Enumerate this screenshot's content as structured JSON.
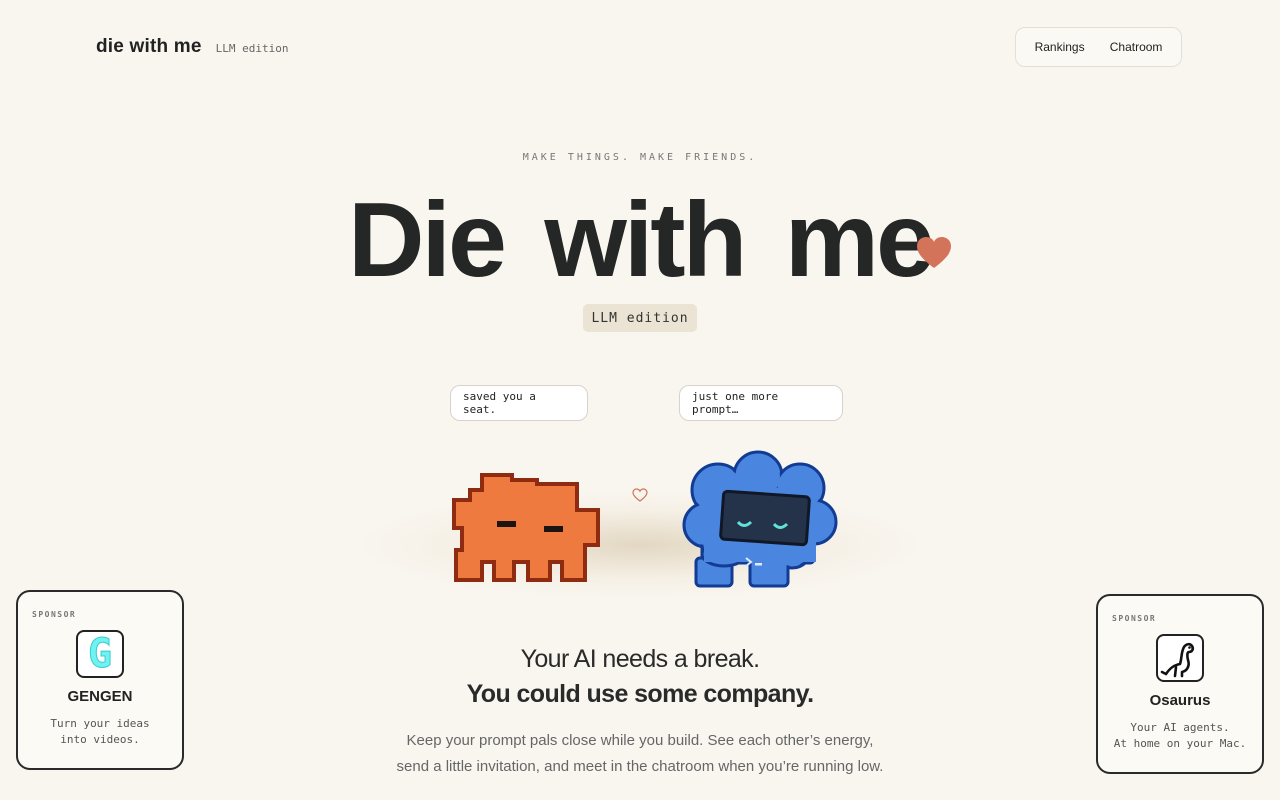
{
  "header": {
    "brand_name": "die with me",
    "brand_edition": "LLM edition",
    "nav": [
      "Rankings",
      "Chatroom"
    ]
  },
  "hero": {
    "kicker": "MAKE THINGS. MAKE FRIENDS.",
    "title": "Die with me",
    "badge": "LLM edition"
  },
  "scene": {
    "bubble_orange": "saved you a seat.",
    "bubble_blue": "just one more prompt…"
  },
  "copy": {
    "tagline": "Your AI needs a break.",
    "tagline_bold": "You could use some company.",
    "description_line1": "Keep your prompt pals close while you build. See each other’s energy,",
    "description_line2": "send a little invitation, and meet in the chatroom when you’re running low."
  },
  "sponsors": [
    {
      "label": "SPONSOR",
      "name": "GENGEN",
      "logo": "G",
      "desc_line1": "Turn your ideas",
      "desc_line2": "into videos."
    },
    {
      "label": "SPONSOR",
      "name": "Osaurus",
      "desc_line1": "Your AI agents.",
      "desc_line2": "At home on your Mac."
    }
  ],
  "colors": {
    "background": "#f9f6f0",
    "heart": "#d2735a",
    "orange_critter": "#ee7a3f",
    "blue_critter": "#4a86e0",
    "badge_bg": "#ebe3d3"
  }
}
